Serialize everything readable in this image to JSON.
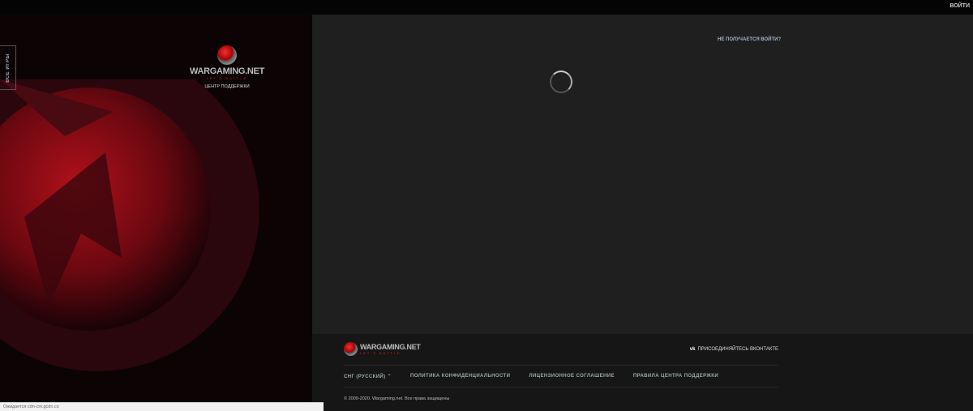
{
  "header": {
    "login": "ВОЙТИ"
  },
  "sidebar": {
    "all_games": "ВСЕ ИГРЫ",
    "brand": "WARGAMING.NET",
    "tagline": "LET'S BATTLE",
    "support_center": "ЦЕНТР ПОДДЕРЖКИ"
  },
  "main": {
    "cant_login": "НЕ ПОЛУЧАЕТСЯ ВОЙТИ?"
  },
  "footer": {
    "brand": "WARGAMING.NET",
    "tagline": "LET'S BATTLE",
    "vk": "ПРИСОЕДИНЯЙТЕСЬ ВКОНТАКТЕ",
    "vk_icon": "vk",
    "links": [
      "СНГ (РУССКИЙ) ⌃",
      "ПОЛИТИКА КОНФИДЕНЦИАЛЬНОСТИ",
      "ЛИЦЕНЗИОННОЕ СОГЛАШЕНИЕ",
      "ПРАВИЛА ЦЕНТРА ПОДДЕРЖКИ"
    ],
    "copyright": "© 2009-2020. Wargaming.net. Все права защищены"
  },
  "status_bar": "Ожидается cdn-cm.gcdn.co"
}
